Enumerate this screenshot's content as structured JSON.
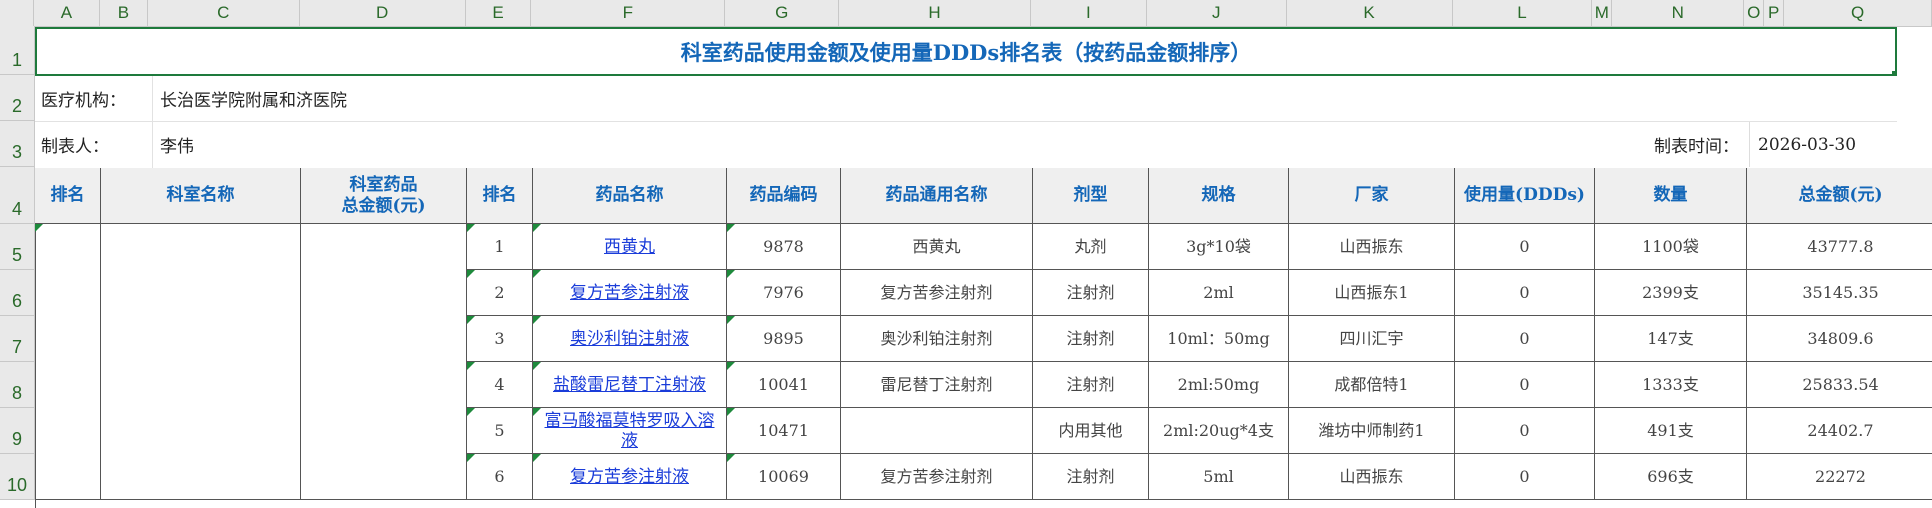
{
  "columns": [
    "A",
    "B",
    "C",
    "D",
    "E",
    "F",
    "G",
    "H",
    "I",
    "J",
    "K",
    "L",
    "M",
    "N",
    "O",
    "P",
    "Q"
  ],
  "rows": [
    "1",
    "2",
    "3",
    "4",
    "5",
    "6",
    "7",
    "8",
    "9",
    "10"
  ],
  "title": "科室药品使用金额及使用量DDDs排名表（按药品金额排序）",
  "org_label": "医疗机构：",
  "org_value": "长治医学院附属和济医院",
  "maker_label": "制表人：",
  "maker_value": "李伟",
  "time_label": "制表时间：",
  "time_value": "2026-03-30",
  "headers": [
    "排名",
    "科室名称",
    "科室药品\n总金额(元)",
    "排名",
    "药品名称",
    "药品编码",
    "药品通用名称",
    "剂型",
    "规格",
    "厂家",
    "使用量(DDDs)",
    "数量",
    "总金额(元)"
  ],
  "drugs": [
    {
      "rank": "1",
      "name": "西黄丸",
      "code": "9878",
      "generic": "西黄丸",
      "form": "丸剂",
      "spec": "3g*10袋",
      "maker": "山西振东",
      "ddds": "0",
      "qty": "1100袋",
      "amount": "43777.8"
    },
    {
      "rank": "2",
      "name": "复方苦参注射液",
      "code": "7976",
      "generic": "复方苦参注射剂",
      "form": "注射剂",
      "spec": "2ml",
      "maker": "山西振东1",
      "ddds": "0",
      "qty": "2399支",
      "amount": "35145.35"
    },
    {
      "rank": "3",
      "name": "奥沙利铂注射液",
      "code": "9895",
      "generic": "奥沙利铂注射剂",
      "form": "注射剂",
      "spec": "10ml：50mg",
      "maker": "四川汇宇",
      "ddds": "0",
      "qty": "147支",
      "amount": "34809.6"
    },
    {
      "rank": "4",
      "name": "盐酸雷尼替丁注射液",
      "code": "10041",
      "generic": "雷尼替丁注射剂",
      "form": "注射剂",
      "spec": "2ml:50mg",
      "maker": "成都倍特1",
      "ddds": "0",
      "qty": "1333支",
      "amount": "25833.54"
    },
    {
      "rank": "5",
      "name": "富马酸福莫特罗吸入溶液",
      "code": "10471",
      "generic": "",
      "form": "内用其他",
      "spec": "2ml:20ug*4支",
      "maker": "潍坊中师制药1",
      "ddds": "0",
      "qty": "491支",
      "amount": "24402.7"
    },
    {
      "rank": "6",
      "name": "复方苦参注射液",
      "code": "10069",
      "generic": "复方苦参注射剂",
      "form": "注射剂",
      "spec": "5ml",
      "maker": "山西振东",
      "ddds": "0",
      "qty": "696支",
      "amount": "22272"
    }
  ]
}
